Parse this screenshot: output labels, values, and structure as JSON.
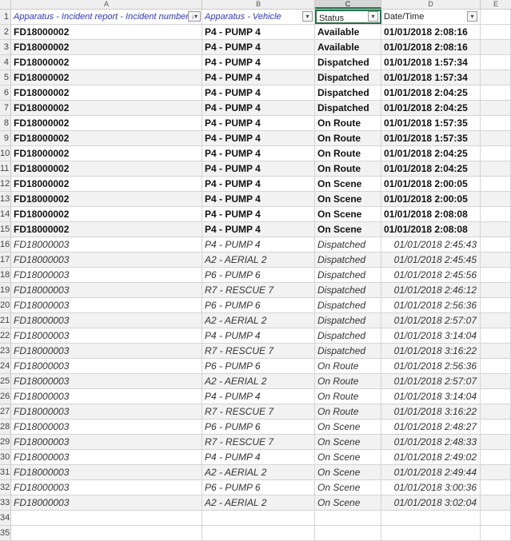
{
  "columns": {
    "A": "A",
    "B": "B",
    "C": "C",
    "D": "D",
    "E": "E"
  },
  "header": {
    "row_num": "1",
    "incident": "Apparatus - Incident report - Incident number",
    "vehicle": "Apparatus - Vehicle",
    "status": "Status",
    "datetime": "Date/Time"
  },
  "rows": [
    {
      "n": "2",
      "incident": "FD18000002",
      "vehicle": "P4 - PUMP 4",
      "status": "Available",
      "datetime": "01/01/2018 2:08:16"
    },
    {
      "n": "3",
      "incident": "FD18000002",
      "vehicle": "P4 - PUMP 4",
      "status": "Available",
      "datetime": "01/01/2018 2:08:16"
    },
    {
      "n": "4",
      "incident": "FD18000002",
      "vehicle": "P4 - PUMP 4",
      "status": "Dispatched",
      "datetime": "01/01/2018 1:57:34"
    },
    {
      "n": "5",
      "incident": "FD18000002",
      "vehicle": "P4 - PUMP 4",
      "status": "Dispatched",
      "datetime": "01/01/2018 1:57:34"
    },
    {
      "n": "6",
      "incident": "FD18000002",
      "vehicle": "P4 - PUMP 4",
      "status": "Dispatched",
      "datetime": "01/01/2018 2:04:25"
    },
    {
      "n": "7",
      "incident": "FD18000002",
      "vehicle": "P4 - PUMP 4",
      "status": "Dispatched",
      "datetime": "01/01/2018 2:04:25"
    },
    {
      "n": "8",
      "incident": "FD18000002",
      "vehicle": "P4 - PUMP 4",
      "status": "On Route",
      "datetime": "01/01/2018 1:57:35"
    },
    {
      "n": "9",
      "incident": "FD18000002",
      "vehicle": "P4 - PUMP 4",
      "status": "On Route",
      "datetime": "01/01/2018 1:57:35"
    },
    {
      "n": "10",
      "incident": "FD18000002",
      "vehicle": "P4 - PUMP 4",
      "status": "On Route",
      "datetime": "01/01/2018 2:04:25"
    },
    {
      "n": "11",
      "incident": "FD18000002",
      "vehicle": "P4 - PUMP 4",
      "status": "On Route",
      "datetime": "01/01/2018 2:04:25"
    },
    {
      "n": "12",
      "incident": "FD18000002",
      "vehicle": "P4 - PUMP 4",
      "status": "On Scene",
      "datetime": "01/01/2018 2:00:05"
    },
    {
      "n": "13",
      "incident": "FD18000002",
      "vehicle": "P4 - PUMP 4",
      "status": "On Scene",
      "datetime": "01/01/2018 2:00:05"
    },
    {
      "n": "14",
      "incident": "FD18000002",
      "vehicle": "P4 - PUMP 4",
      "status": "On Scene",
      "datetime": "01/01/2018 2:08:08"
    },
    {
      "n": "15",
      "incident": "FD18000002",
      "vehicle": "P4 - PUMP 4",
      "status": "On Scene",
      "datetime": "01/01/2018 2:08:08"
    },
    {
      "n": "16",
      "incident": "FD18000003",
      "vehicle": "P4 - PUMP 4",
      "status": "Dispatched",
      "datetime": "01/01/2018 2:45:43"
    },
    {
      "n": "17",
      "incident": "FD18000003",
      "vehicle": "A2 - AERIAL 2",
      "status": "Dispatched",
      "datetime": "01/01/2018 2:45:45"
    },
    {
      "n": "18",
      "incident": "FD18000003",
      "vehicle": "P6 - PUMP 6",
      "status": "Dispatched",
      "datetime": "01/01/2018 2:45:56"
    },
    {
      "n": "19",
      "incident": "FD18000003",
      "vehicle": "R7 - RESCUE 7",
      "status": "Dispatched",
      "datetime": "01/01/2018 2:46:12"
    },
    {
      "n": "20",
      "incident": "FD18000003",
      "vehicle": "P6 - PUMP 6",
      "status": "Dispatched",
      "datetime": "01/01/2018 2:56:36"
    },
    {
      "n": "21",
      "incident": "FD18000003",
      "vehicle": "A2 - AERIAL 2",
      "status": "Dispatched",
      "datetime": "01/01/2018 2:57:07"
    },
    {
      "n": "22",
      "incident": "FD18000003",
      "vehicle": "P4 - PUMP 4",
      "status": "Dispatched",
      "datetime": "01/01/2018 3:14:04"
    },
    {
      "n": "23",
      "incident": "FD18000003",
      "vehicle": "R7 - RESCUE 7",
      "status": "Dispatched",
      "datetime": "01/01/2018 3:16:22"
    },
    {
      "n": "24",
      "incident": "FD18000003",
      "vehicle": "P6 - PUMP 6",
      "status": "On Route",
      "datetime": "01/01/2018 2:56:36"
    },
    {
      "n": "25",
      "incident": "FD18000003",
      "vehicle": "A2 - AERIAL 2",
      "status": "On Route",
      "datetime": "01/01/2018 2:57:07"
    },
    {
      "n": "26",
      "incident": "FD18000003",
      "vehicle": "P4 - PUMP 4",
      "status": "On Route",
      "datetime": "01/01/2018 3:14:04"
    },
    {
      "n": "27",
      "incident": "FD18000003",
      "vehicle": "R7 - RESCUE 7",
      "status": "On Route",
      "datetime": "01/01/2018 3:16:22"
    },
    {
      "n": "28",
      "incident": "FD18000003",
      "vehicle": "P6 - PUMP 6",
      "status": "On Scene",
      "datetime": "01/01/2018 2:48:27"
    },
    {
      "n": "29",
      "incident": "FD18000003",
      "vehicle": "R7 - RESCUE 7",
      "status": "On Scene",
      "datetime": "01/01/2018 2:48:33"
    },
    {
      "n": "30",
      "incident": "FD18000003",
      "vehicle": "P4 - PUMP 4",
      "status": "On Scene",
      "datetime": "01/01/2018 2:49:02"
    },
    {
      "n": "31",
      "incident": "FD18000003",
      "vehicle": "A2 - AERIAL 2",
      "status": "On Scene",
      "datetime": "01/01/2018 2:49:44"
    },
    {
      "n": "32",
      "incident": "FD18000003",
      "vehicle": "P6 - PUMP 6",
      "status": "On Scene",
      "datetime": "01/01/2018 3:00:36"
    },
    {
      "n": "33",
      "incident": "FD18000003",
      "vehicle": "A2 - AERIAL 2",
      "status": "On Scene",
      "datetime": "01/01/2018 3:02:04"
    }
  ],
  "empty_rows": [
    {
      "n": "34"
    },
    {
      "n": "35"
    }
  ],
  "icons": {
    "filter": "▾",
    "sort_filter": "↓▾"
  },
  "colors": {
    "header_link": "#2b36c8",
    "selection": "#217346"
  }
}
